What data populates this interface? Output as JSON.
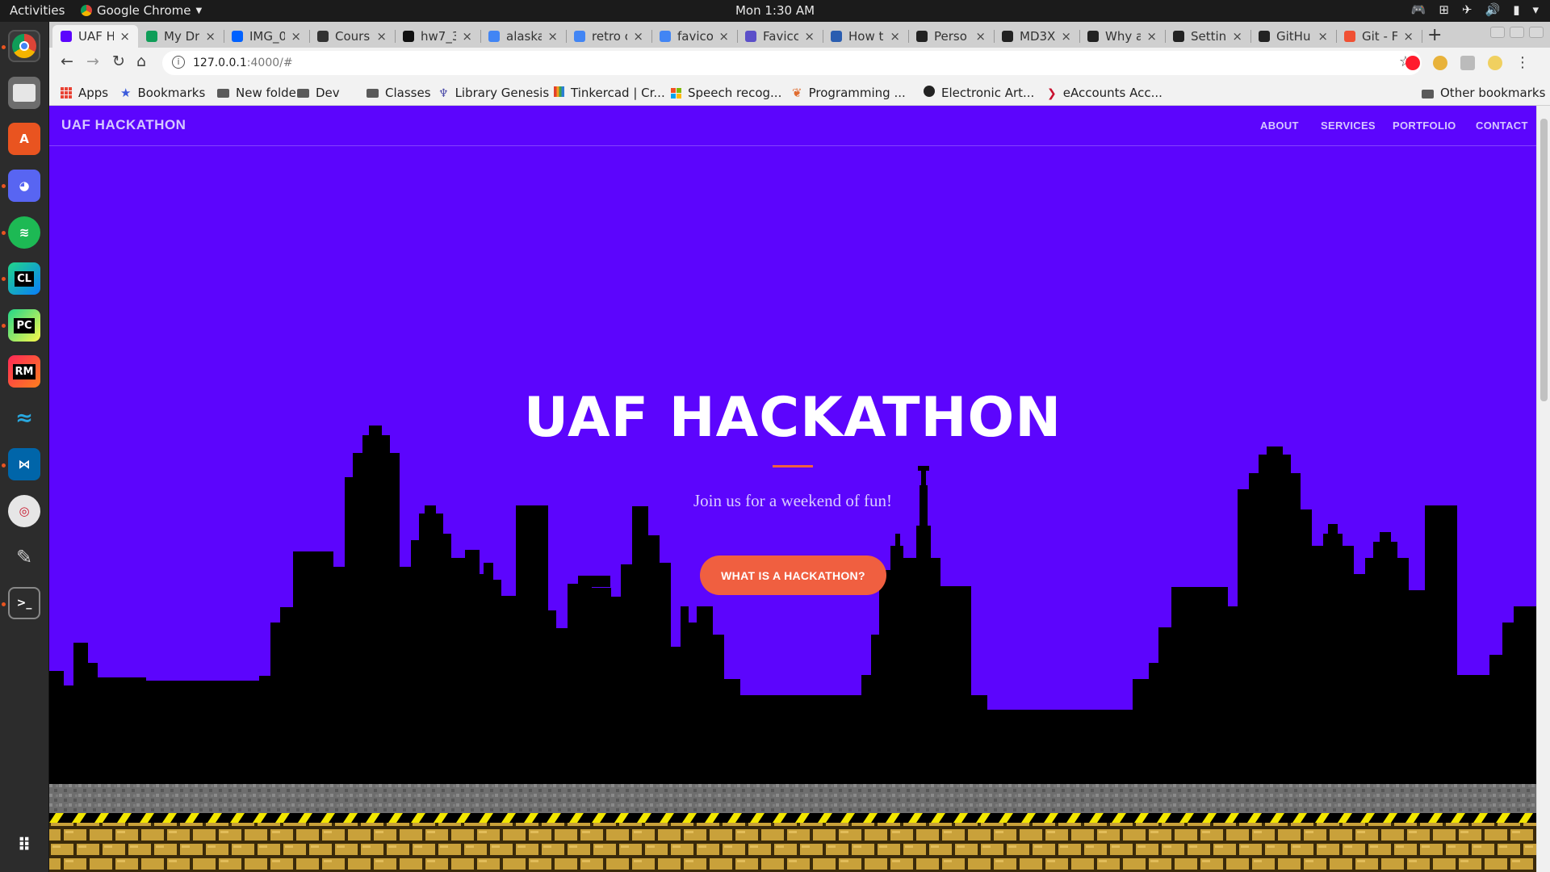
{
  "os": {
    "activities": "Activities",
    "app_name": "Google Chrome",
    "clock": "Mon  1:30 AM"
  },
  "browser": {
    "tabs": [
      {
        "title": "UAF H",
        "favicon_color": "#5c05fd",
        "active": true
      },
      {
        "title": "My Dr",
        "favicon_color": "#0f9d58"
      },
      {
        "title": "IMG_0",
        "favicon_color": "#0061ff"
      },
      {
        "title": "Cours",
        "favicon_color": "#333333"
      },
      {
        "title": "hw7_3",
        "favicon_color": "#111111"
      },
      {
        "title": "alaska",
        "favicon_color": "#4285f4"
      },
      {
        "title": "retro c",
        "favicon_color": "#4285f4"
      },
      {
        "title": "favico",
        "favicon_color": "#4285f4"
      },
      {
        "title": "Favicc",
        "favicon_color": "#5b4fc9"
      },
      {
        "title": "How t",
        "favicon_color": "#2a5db0"
      },
      {
        "title": "Perso",
        "favicon_color": "#222222"
      },
      {
        "title": "MD3X",
        "favicon_color": "#222222"
      },
      {
        "title": "Why a",
        "favicon_color": "#222222"
      },
      {
        "title": "Settin",
        "favicon_color": "#222222"
      },
      {
        "title": "GitHu",
        "favicon_color": "#222222"
      },
      {
        "title": "Git - Fi",
        "favicon_color": "#f05033"
      }
    ],
    "url_host": "127.0.0.1",
    "url_path": ":4000/#",
    "bookmarks": [
      {
        "label": "Apps",
        "icon": "apps-grid-icon"
      },
      {
        "label": "Bookmarks",
        "icon": "star-icon"
      },
      {
        "label": "New folder",
        "icon": "folder-icon"
      },
      {
        "label": "Dev",
        "icon": "folder-icon"
      },
      {
        "label": "Classes",
        "icon": "folder-icon"
      },
      {
        "label": "Library Genesis",
        "icon": "libgen-icon"
      },
      {
        "label": "Tinkercad | Cr...",
        "icon": "tinkercad-icon"
      },
      {
        "label": "Speech recog...",
        "icon": "microsoft-icon"
      },
      {
        "label": "Programming ...",
        "icon": "programming-icon"
      },
      {
        "label": "Electronic Art...",
        "icon": "ea-icon"
      },
      {
        "label": "eAccounts Acc...",
        "icon": "eaccounts-icon"
      }
    ],
    "other_bookmarks": "Other bookmarks"
  },
  "site": {
    "brand": "UAF HACKATHON",
    "nav": [
      "ABOUT",
      "SERVICES",
      "PORTFOLIO",
      "CONTACT"
    ],
    "hero_title": "UAF HACKATHON",
    "tagline": "Join us for a weekend of fun!",
    "cta": "WHAT IS A HACKATHON?"
  },
  "colors": {
    "hero_background": "#5c05fd",
    "accent": "#f05f40",
    "skyline": "#000000",
    "hazard_yellow": "#f2e600",
    "brick": "#c9a13a"
  },
  "dock_apps": [
    "chrome-icon",
    "files-icon",
    "software-center-icon",
    "discord-icon",
    "spotify-icon",
    "clion-icon",
    "pycharm-icon",
    "rubymine-icon",
    "dolphin-icon",
    "vscode-icon",
    "shotwell-icon",
    "gimp-icon",
    "terminal-icon",
    "show-apps-icon"
  ]
}
